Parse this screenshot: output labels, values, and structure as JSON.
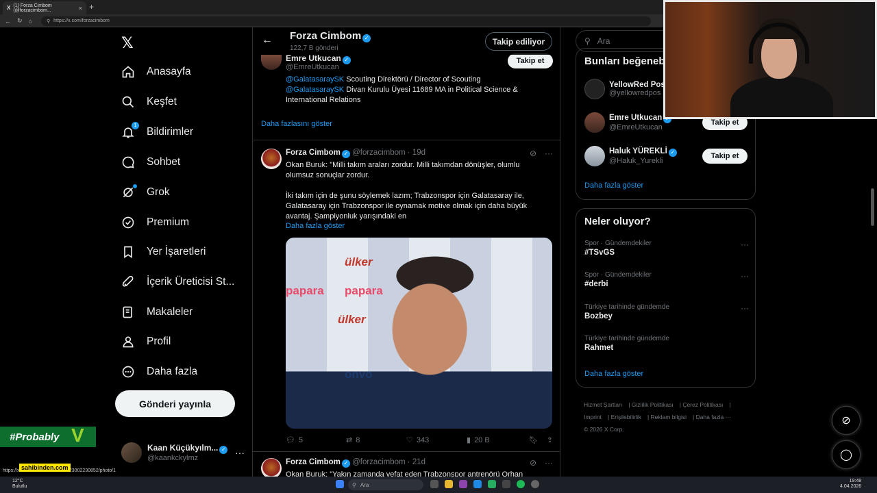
{
  "browser": {
    "tab_title": "(1) Forza Cimbom (@forzacimbom...",
    "url": "https://x.com/forzacimbom"
  },
  "nav": {
    "items": [
      {
        "label": "Anasayfa",
        "icon": "home-icon"
      },
      {
        "label": "Keşfet",
        "icon": "search-icon"
      },
      {
        "label": "Bildirimler",
        "icon": "bell-icon",
        "badge": "1"
      },
      {
        "label": "Sohbet",
        "icon": "chat-icon"
      },
      {
        "label": "Grok",
        "icon": "grok-icon"
      },
      {
        "label": "Premium",
        "icon": "premium-icon"
      },
      {
        "label": "Yer İşaretleri",
        "icon": "bookmark-icon"
      },
      {
        "label": "İçerik Üreticisi St...",
        "icon": "rocket-icon"
      },
      {
        "label": "Makaleler",
        "icon": "article-icon"
      },
      {
        "label": "Profil",
        "icon": "profile-icon"
      },
      {
        "label": "Daha fazla",
        "icon": "more-circle-icon"
      }
    ],
    "post_button": "Gönderi yayınla",
    "account": {
      "name": "Kaan Küçükyılm...",
      "handle": "@kaankckylmz"
    }
  },
  "overlay": {
    "probably": "#Probably",
    "sahibinden": "sahibinden.com",
    "status_url": "https://x.com/i/status/2040466623002230852/photo/1"
  },
  "profile_header": {
    "title": "Forza Cimbom",
    "post_count": "122,7 B gönderi",
    "follow_state": "Takip ediliyor"
  },
  "user_cell": {
    "name": "Emre Utkucan",
    "handle": "@EmreUtkucan",
    "follow": "Takip et",
    "bio_line1_mention": "@GalatasaraySK",
    "bio_line1_text": " Scouting Direktörü / Director of Scouting",
    "bio_line2_mention": "@GalatasaraySK",
    "bio_line2_text": " Divan Kurulu Üyesi 11689 MA in Political Science & International Relations",
    "show_more": "Daha fazlasını göster"
  },
  "tweet1": {
    "name": "Forza Cimbom",
    "handle": "@forzacimbom",
    "time": "19d",
    "text1": "Okan Buruk: \"Milli takım araları zordur. Milli takımdan dönüşler, olumlu olumsuz sonuçlar zordur.",
    "text2": "İki takım için de şunu söylemek lazım; Trabzonspor için Galatasaray ile, Galatasaray için Trabzonspor ile oynamak motive olmak için daha büyük avantaj. Şampiyonluk yarışındaki en",
    "show_more": "Daha fazla göster",
    "replies": "5",
    "reposts": "8",
    "likes": "343",
    "views": "20 B",
    "media_sponsors": [
      "ülker",
      "papara",
      "onvo",
      "ülker",
      "papara"
    ]
  },
  "tweet2": {
    "name": "Forza Cimbom",
    "handle": "@forzacimbom",
    "time": "21d",
    "text": "Okan Buruk: \"Yakın zamanda vefat eden Trabzonspor antrenörü Orhan"
  },
  "right": {
    "search_placeholder": "Ara",
    "who_title": "Bunları beğenebilirsin",
    "who": [
      {
        "name": "YellowRed Pos",
        "handle": "@yellowredpos",
        "button": ""
      },
      {
        "name": "Emre Utkucan",
        "handle": "@EmreUtkucan",
        "button": "Takip et"
      },
      {
        "name": "Haluk YÜREKLİ",
        "handle": "@Haluk_Yurekli",
        "button": "Takip et"
      }
    ],
    "who_more": "Daha fazla göster",
    "trends_title": "Neler oluyor?",
    "trends": [
      {
        "category": "Spor · Gündemdekiler",
        "topic": "#TSvGS"
      },
      {
        "category": "Spor · Gündemdekiler",
        "topic": "#derbi"
      },
      {
        "category": "Türkiye tarihinde gündemde",
        "topic": "Bozbey"
      },
      {
        "category": "Türkiye tarihinde gündemde",
        "topic": "Rahmet"
      }
    ],
    "trends_more": "Daha fazla göster",
    "footer": [
      "Hizmet Şartları",
      "Gizlilik Politikası",
      "Çerez Politikası",
      "Imprint",
      "Erişilebilirlik",
      "Reklam bilgisi",
      "Daha fazla ···",
      "© 2026 X Corp."
    ]
  },
  "taskbar": {
    "temp": "12°C",
    "weather": "Bulutlu",
    "search": "Ara",
    "time": "19:48",
    "date": "4.04.2026"
  }
}
